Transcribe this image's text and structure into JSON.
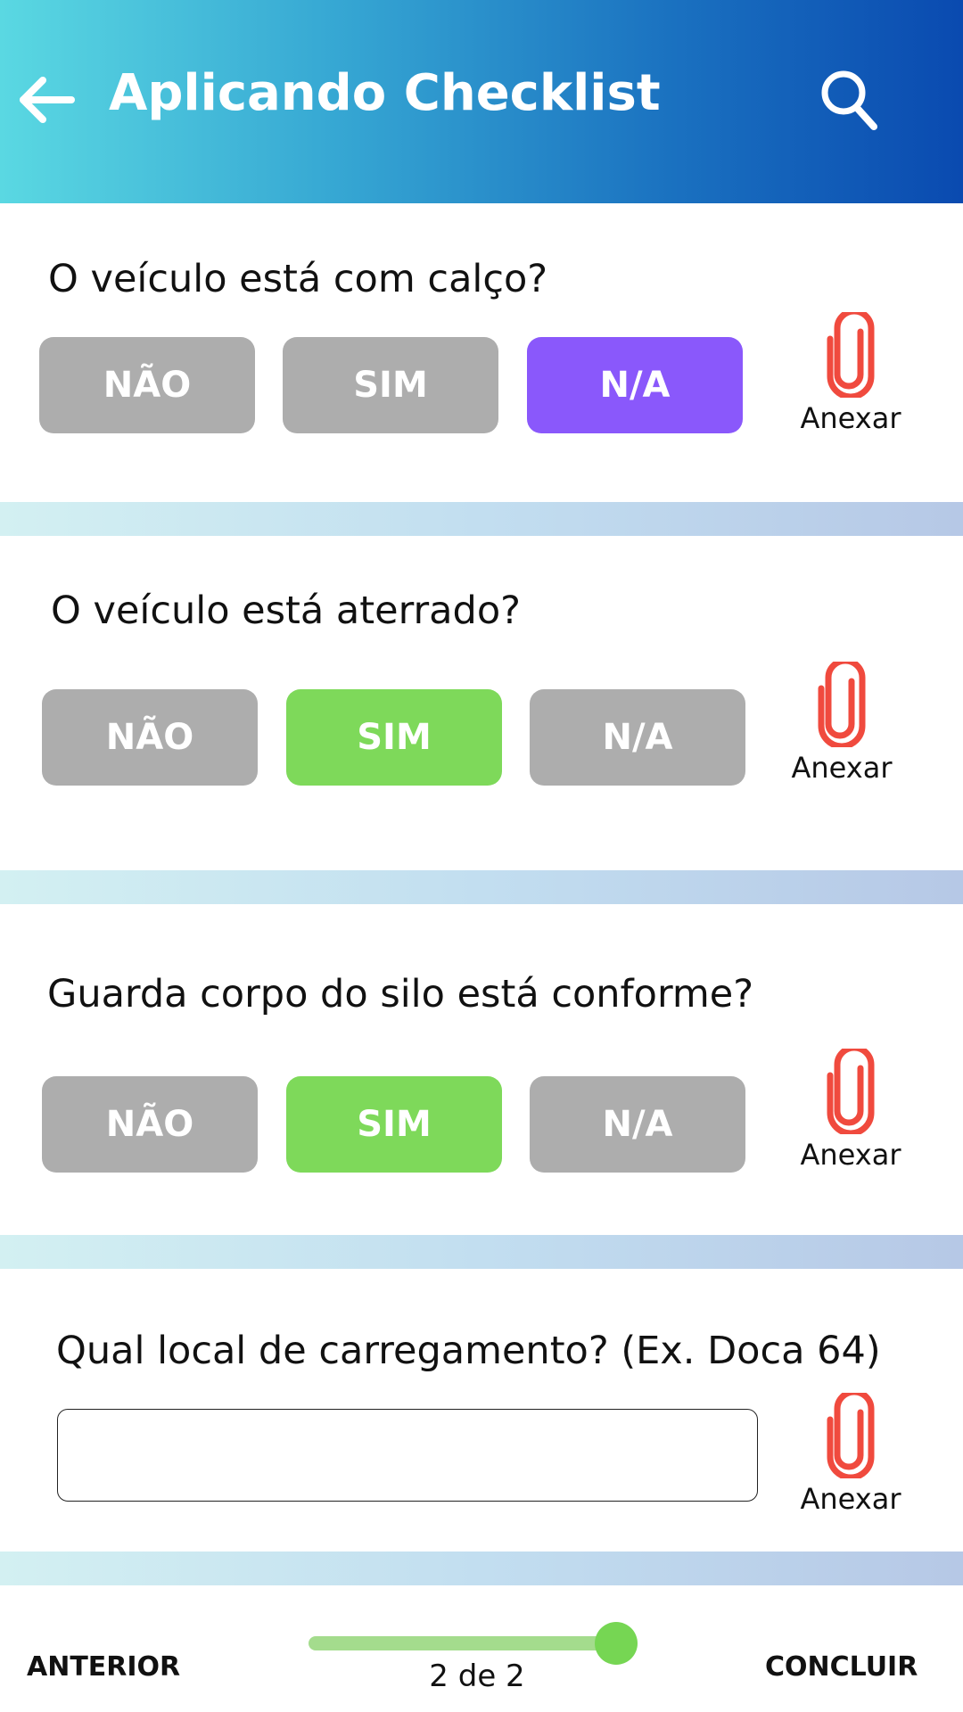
{
  "header": {
    "title": "Aplicando Checklist",
    "back_icon": "arrow-left-icon",
    "search_icon": "search-icon",
    "gradient": [
      "#5ad8e2",
      "#0a4ab0"
    ]
  },
  "questions": [
    {
      "text": "O veículo está com calço?",
      "options": [
        "NÃO",
        "SIM",
        "N/A"
      ],
      "selected": "N/A",
      "attach_label": "Anexar"
    },
    {
      "text": "O veículo está aterrado?",
      "options": [
        "NÃO",
        "SIM",
        "N/A"
      ],
      "selected": "SIM",
      "attach_label": "Anexar"
    },
    {
      "text": "Guarda corpo do silo está conforme?",
      "options": [
        "NÃO",
        "SIM",
        "N/A"
      ],
      "selected": "SIM",
      "attach_label": "Anexar"
    },
    {
      "text": "Qual local de carregamento? (Ex. Doca 64)",
      "input_value": "",
      "attach_label": "Anexar"
    }
  ],
  "colors": {
    "unselected": "#adadad",
    "selected_na": "#8a58fb",
    "selected_sim": "#7ed95a",
    "attach_icon": "#f04a3e"
  },
  "footer": {
    "previous_label": "ANTERIOR",
    "finish_label": "CONCLUIR",
    "progress_text": "2 de 2",
    "progress_fraction": 1.0
  }
}
